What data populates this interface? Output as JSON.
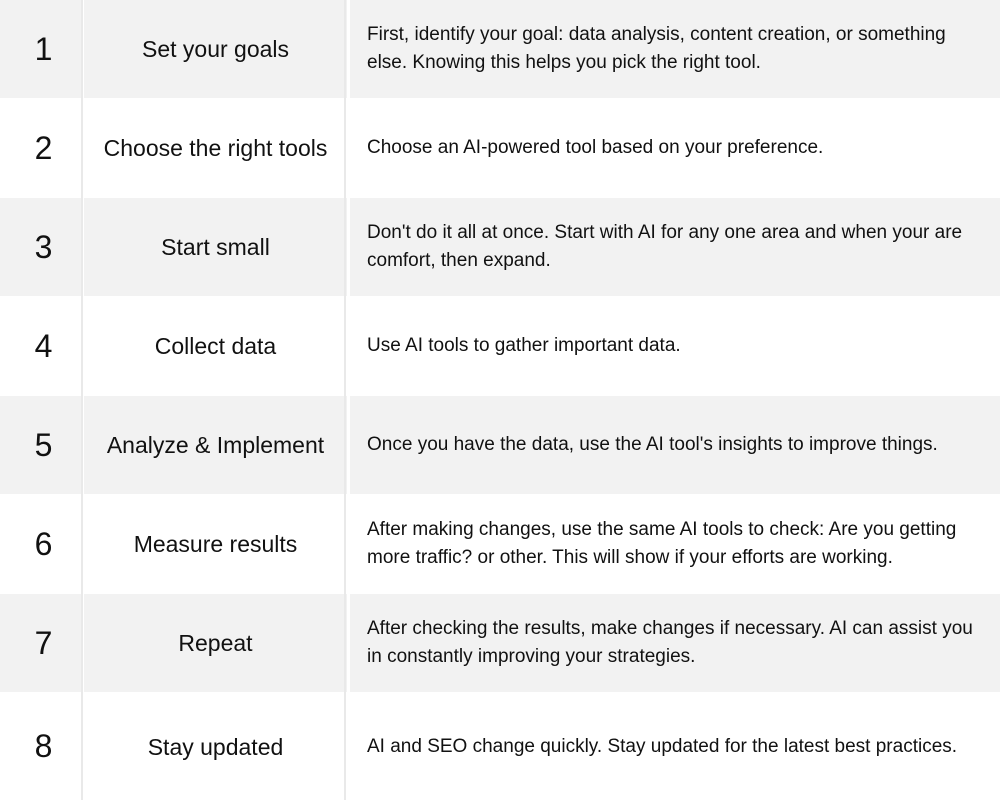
{
  "steps": [
    {
      "number": "1",
      "title": "Set your goals",
      "description": "First, identify your goal: data analysis, content creation, or something else. Knowing this helps you pick the right tool."
    },
    {
      "number": "2",
      "title": "Choose the right tools",
      "description": "Choose an AI-powered tool based on your preference."
    },
    {
      "number": "3",
      "title": "Start small",
      "description": "Don't do it all at once. Start with AI for any one area and when your are comfort, then expand."
    },
    {
      "number": "4",
      "title": "Collect data",
      "description": "Use AI tools to gather important data."
    },
    {
      "number": "5",
      "title": "Analyze & Implement",
      "description": "Once you have the data, use the AI tool's insights to improve things."
    },
    {
      "number": "6",
      "title": "Measure results",
      "description": "After making changes, use the same AI tools to check: Are you getting more traffic? or other. This will show if your efforts are working."
    },
    {
      "number": "7",
      "title": "Repeat",
      "description": "After checking the results, make changes if necessary. AI can assist you in constantly improving your strategies."
    },
    {
      "number": "8",
      "title": "Stay updated",
      "description": "AI and SEO change quickly. Stay updated for the latest best practices."
    }
  ],
  "colors": {
    "shaded_row": "#f2f2f2",
    "plain_row": "#ffffff",
    "divider": "#e9e9e9",
    "text": "#111111"
  }
}
